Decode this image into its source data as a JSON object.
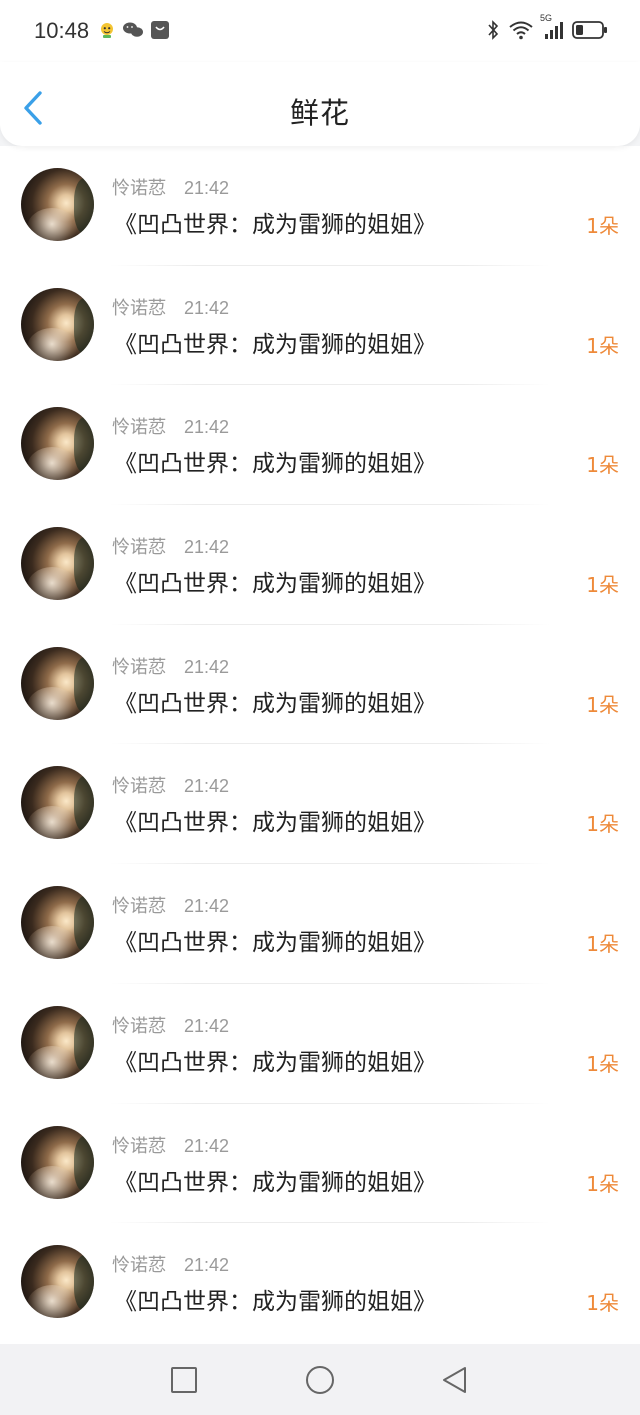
{
  "status_bar": {
    "time": "10:48"
  },
  "header": {
    "title": "鲜花"
  },
  "records": [
    {
      "user": "怜诺荵",
      "time": "21:42",
      "book": "《凹凸世界：成为雷狮的姐姐》",
      "count": "1朵"
    },
    {
      "user": "怜诺荵",
      "time": "21:42",
      "book": "《凹凸世界：成为雷狮的姐姐》",
      "count": "1朵"
    },
    {
      "user": "怜诺荵",
      "time": "21:42",
      "book": "《凹凸世界：成为雷狮的姐姐》",
      "count": "1朵"
    },
    {
      "user": "怜诺荵",
      "time": "21:42",
      "book": "《凹凸世界：成为雷狮的姐姐》",
      "count": "1朵"
    },
    {
      "user": "怜诺荵",
      "time": "21:42",
      "book": "《凹凸世界：成为雷狮的姐姐》",
      "count": "1朵"
    },
    {
      "user": "怜诺荵",
      "time": "21:42",
      "book": "《凹凸世界：成为雷狮的姐姐》",
      "count": "1朵"
    },
    {
      "user": "怜诺荵",
      "time": "21:42",
      "book": "《凹凸世界：成为雷狮的姐姐》",
      "count": "1朵"
    },
    {
      "user": "怜诺荵",
      "time": "21:42",
      "book": "《凹凸世界：成为雷狮的姐姐》",
      "count": "1朵"
    },
    {
      "user": "怜诺荵",
      "time": "21:42",
      "book": "《凹凸世界：成为雷狮的姐姐》",
      "count": "1朵"
    },
    {
      "user": "怜诺荵",
      "time": "21:42",
      "book": "《凹凸世界：成为雷狮的姐姐》",
      "count": "1朵"
    }
  ],
  "colors": {
    "accent_blue": "#3aa0e8",
    "count_orange": "#ee8a3a",
    "meta_gray": "#9a9a9a"
  },
  "icons": {
    "status_left": [
      "app-notification-icon",
      "wechat-icon",
      "shopping-bag-icon"
    ],
    "status_right": [
      "bluetooth-icon",
      "wifi-icon",
      "5g-signal-icon",
      "battery-icon"
    ],
    "header": [
      "back-arrow-icon"
    ],
    "nav": [
      "recent-apps-icon",
      "home-icon",
      "back-icon"
    ]
  },
  "status_bar_network": "5G"
}
